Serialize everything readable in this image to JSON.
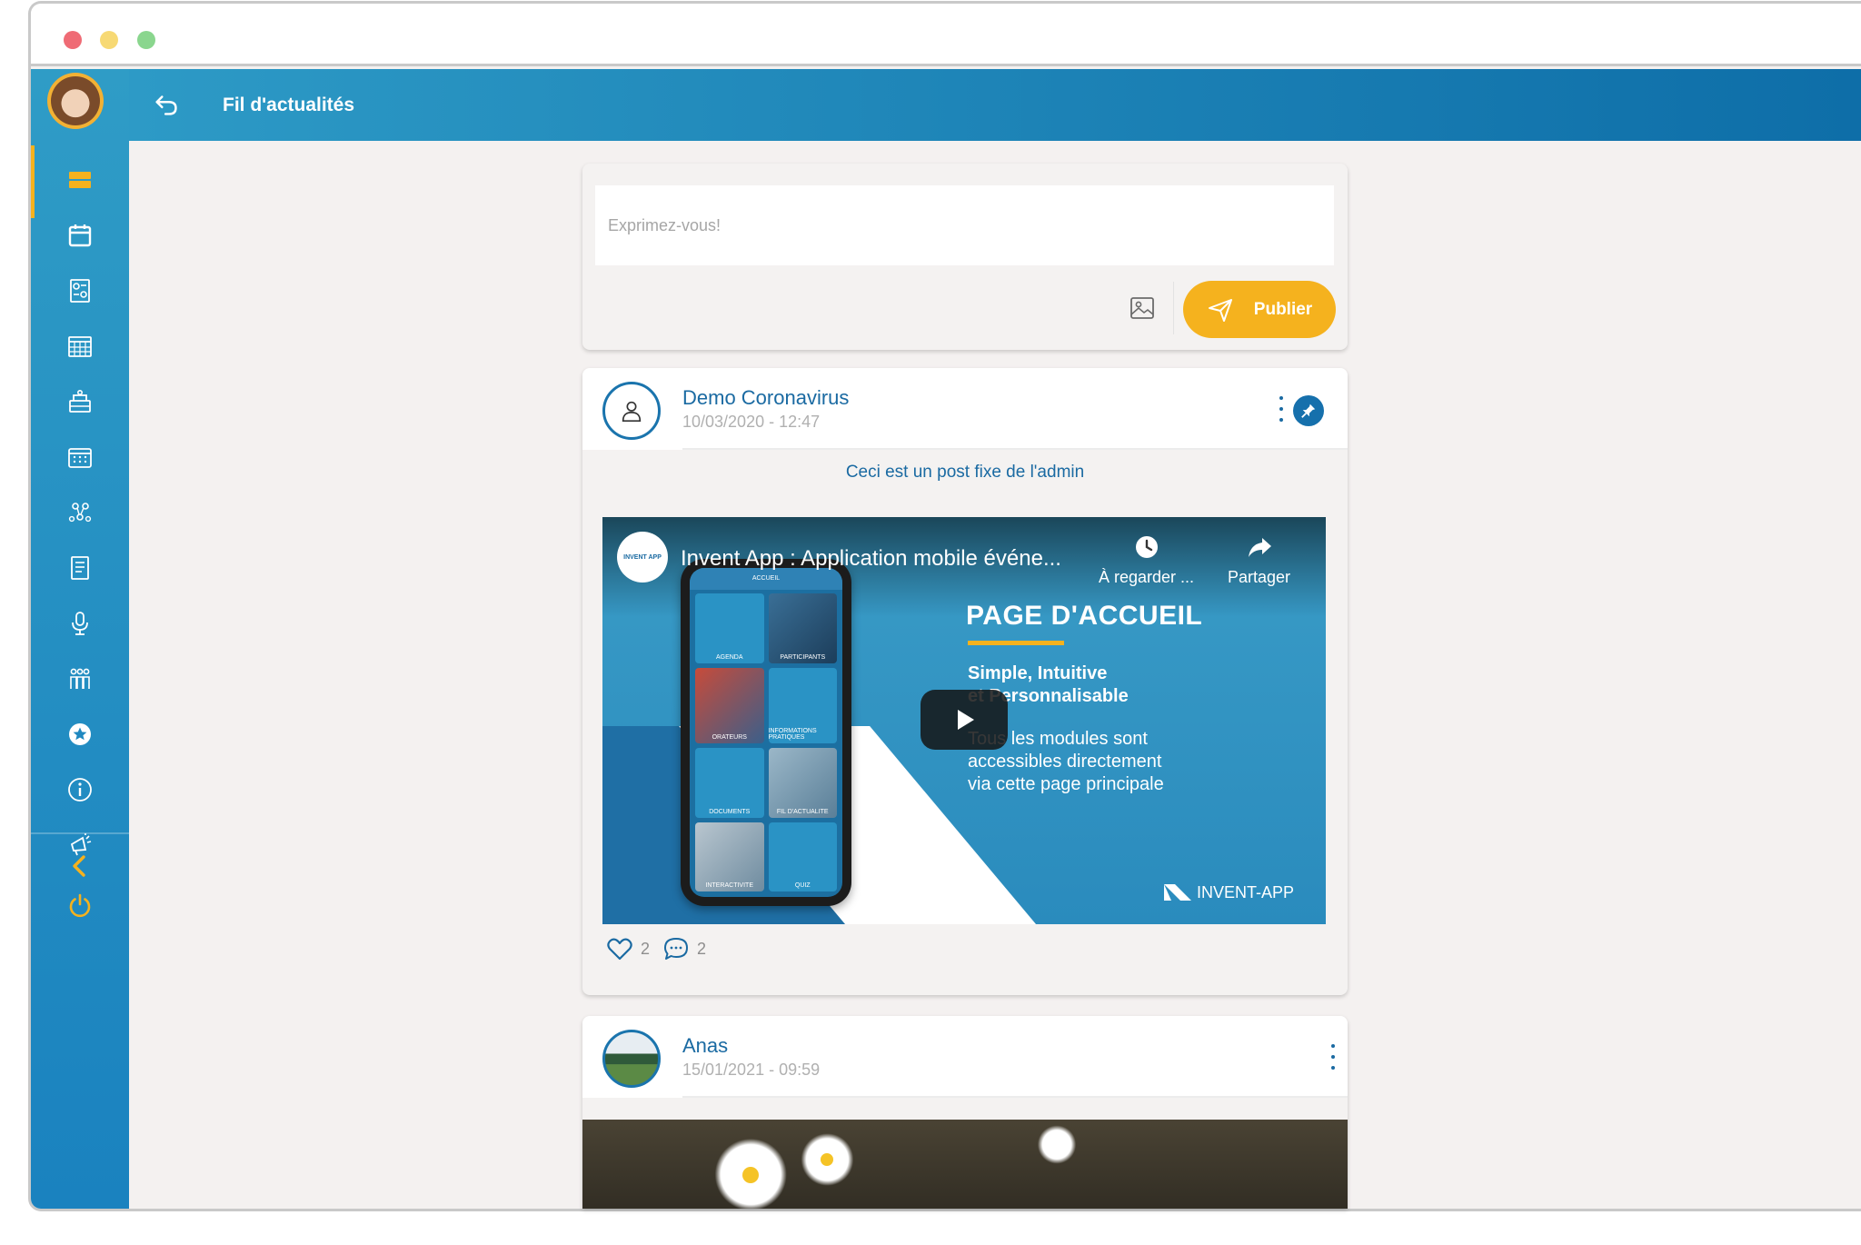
{
  "header": {
    "title": "Fil d'actualités"
  },
  "sidebar": {
    "items": [
      {
        "name": "sidebar-item-news-feed",
        "icon": "feed-icon",
        "active": true
      },
      {
        "name": "sidebar-item-calendar",
        "icon": "calendar-icon"
      },
      {
        "name": "sidebar-item-contacts",
        "icon": "contacts-grid-icon"
      },
      {
        "name": "sidebar-item-schedule",
        "icon": "schedule-grid-icon"
      },
      {
        "name": "sidebar-item-exhibitors",
        "icon": "stand-icon"
      },
      {
        "name": "sidebar-item-agenda",
        "icon": "agenda-icon"
      },
      {
        "name": "sidebar-item-networking",
        "icon": "network-icon"
      },
      {
        "name": "sidebar-item-documents",
        "icon": "document-icon"
      },
      {
        "name": "sidebar-item-speakers",
        "icon": "microphone-icon"
      },
      {
        "name": "sidebar-item-participants",
        "icon": "people-icon"
      },
      {
        "name": "sidebar-item-favorites",
        "icon": "star-icon"
      },
      {
        "name": "sidebar-item-info",
        "icon": "info-icon"
      },
      {
        "name": "sidebar-item-announcements",
        "icon": "megaphone-icon"
      }
    ],
    "collapse_icon": "chevron-left-icon",
    "logout_icon": "power-icon",
    "accent": "#f5b21e"
  },
  "composer": {
    "placeholder": "Exprimez-vous!",
    "publish_label": "Publier"
  },
  "posts": [
    {
      "author": "Demo Coronavirus",
      "date": "10/03/2020 - 12:47",
      "text": "Ceci est un post fixe de l'admin",
      "pinned": true,
      "likes": "2",
      "comments": "2",
      "video": {
        "title": "Invent App : Application mobile événe...",
        "watch_later": "À regarder ...",
        "share": "Partager",
        "heading": "PAGE D'ACCUEIL",
        "sub_line1": "Simple, Intuitive",
        "sub_line2": "et Personnalisable",
        "desc_line1": "Tous les modules sont",
        "desc_line2": "accessibles directement",
        "desc_line3": "via cette page principale",
        "logo": "INVENT-APP",
        "channel": "INVENT APP",
        "phone_bar": "ACCUEIL",
        "tiles": [
          "AGENDA",
          "PARTICIPANTS",
          "ORATEURS",
          "INFORMATIONS PRATIQUES",
          "DOCUMENTS",
          "FIL D'ACTUALITE",
          "INTERACTIVITE",
          "QUIZ"
        ]
      }
    },
    {
      "author": "Anas",
      "date": "15/01/2021 - 09:59"
    }
  ],
  "colors": {
    "primary": "#1a6aa2",
    "header_start": "#2d9ac6",
    "header_end": "#0e6ea8",
    "publish": "#f5b21e",
    "background": "#f4f1f0"
  }
}
